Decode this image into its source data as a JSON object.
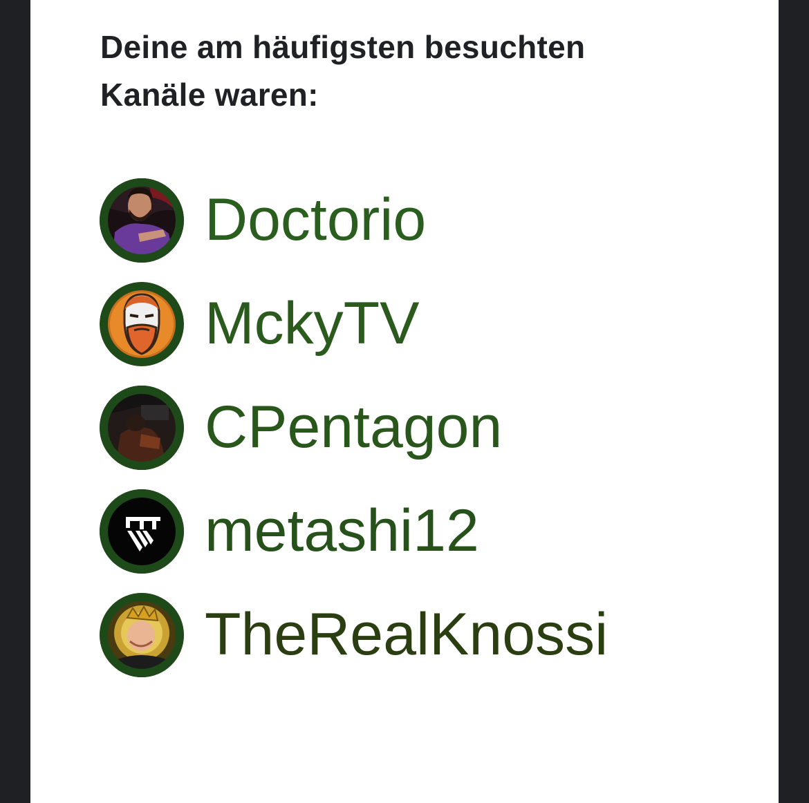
{
  "heading": "Deine am häufigsten besuchten Kanäle waren:",
  "colors": {
    "background_outer": "#1f2023",
    "card": "#ffffff",
    "heading_text": "#202124",
    "avatar_ring": "#1e4a1a"
  },
  "channels": [
    {
      "name": "Doctorio",
      "avatar_icon": "avatar-photo-man-purple-shirt",
      "color": "#2a5e1e"
    },
    {
      "name": "MckyTV",
      "avatar_icon": "avatar-bearded-face-logo",
      "color": "#2a5a1c"
    },
    {
      "name": "CPentagon",
      "avatar_icon": "avatar-dark-room-photo",
      "color": "#28561b"
    },
    {
      "name": "metashi12",
      "avatar_icon": "avatar-geometric-logo",
      "color": "#26511a"
    },
    {
      "name": "TheRealKnossi",
      "avatar_icon": "avatar-photo-crowned-man",
      "color": "#2b3e12"
    }
  ]
}
